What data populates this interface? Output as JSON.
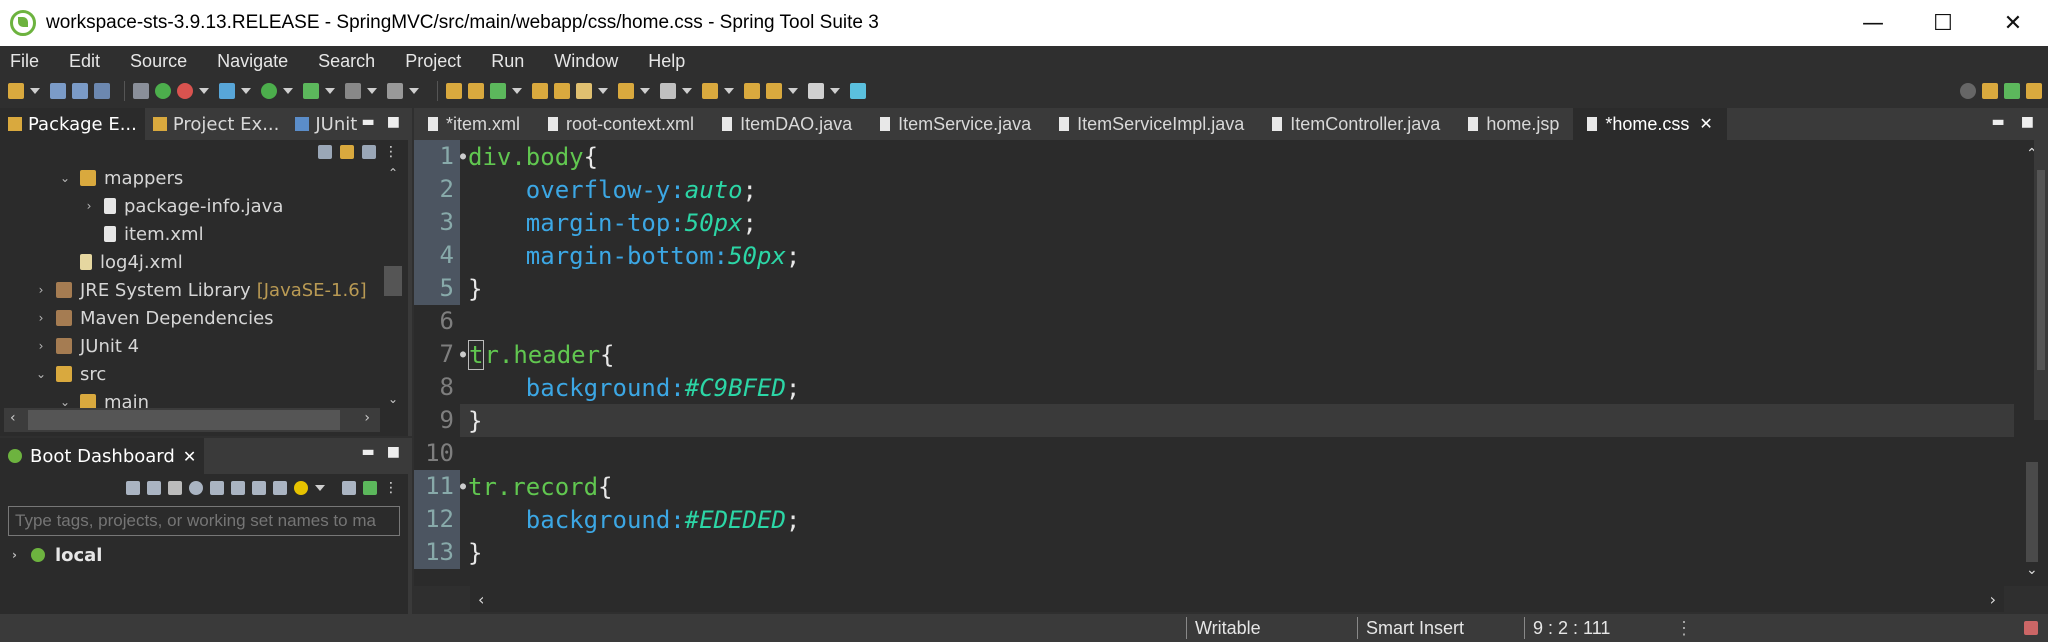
{
  "window": {
    "title": "workspace-sts-3.9.13.RELEASE - SpringMVC/src/main/webapp/css/home.css - Spring Tool Suite 3",
    "minimize": "—",
    "maximize": "☐",
    "close": "✕"
  },
  "menu": [
    "File",
    "Edit",
    "Source",
    "Navigate",
    "Search",
    "Project",
    "Run",
    "Window",
    "Help"
  ],
  "left_panel": {
    "tabs": [
      {
        "label": "Package E..."
      },
      {
        "label": "Project Ex..."
      },
      {
        "label": "JUnit"
      }
    ],
    "tree": [
      {
        "label": "mappers",
        "depth": 2,
        "arrow": "v",
        "icon": "package-icon"
      },
      {
        "label": "package-info.java",
        "depth": 3,
        "arrow": ">",
        "icon": "java-file-icon"
      },
      {
        "label": "item.xml",
        "depth": 3,
        "arrow": "",
        "icon": "xml-file-icon"
      },
      {
        "label": "log4j.xml",
        "depth": 2,
        "arrow": "",
        "icon": "xml-file-icon"
      },
      {
        "label": "JRE System Library",
        "suffix": "[JavaSE-1.6]",
        "depth": 1,
        "arrow": ">",
        "icon": "library-icon"
      },
      {
        "label": "Maven Dependencies",
        "depth": 1,
        "arrow": ">",
        "icon": "library-icon"
      },
      {
        "label": "JUnit 4",
        "depth": 1,
        "arrow": ">",
        "icon": "library-icon"
      },
      {
        "label": "src",
        "depth": 1,
        "arrow": "v",
        "icon": "folder-icon"
      },
      {
        "label": "main",
        "depth": 2,
        "arrow": "v",
        "icon": "folder-icon"
      }
    ]
  },
  "boot_dashboard": {
    "tab_label": "Boot Dashboard",
    "filter_placeholder": "Type tags, projects, or working set names to ma",
    "local_label": "local"
  },
  "editor": {
    "tabs": [
      {
        "label": "*item.xml",
        "active": false
      },
      {
        "label": "root-context.xml",
        "active": false
      },
      {
        "label": "ItemDAO.java",
        "active": false
      },
      {
        "label": "ItemService.java",
        "active": false
      },
      {
        "label": "ItemServiceImpl.java",
        "active": false
      },
      {
        "label": "ItemController.java",
        "active": false
      },
      {
        "label": "home.jsp",
        "active": false
      },
      {
        "label": "*home.css",
        "active": true
      }
    ],
    "lines": [
      {
        "num": "1",
        "selector": "div.body",
        "open": "{"
      },
      {
        "num": "2",
        "prop": "overflow-y",
        "value": "auto"
      },
      {
        "num": "3",
        "prop": "margin-top",
        "value": "50px"
      },
      {
        "num": "4",
        "prop": "margin-bottom",
        "value": "50px"
      },
      {
        "num": "5",
        "close": "}"
      },
      {
        "num": "6"
      },
      {
        "num": "7",
        "selector_first": "t",
        "selector": "r.header",
        "open": "{"
      },
      {
        "num": "8",
        "prop": "background",
        "value": "#C9BFED"
      },
      {
        "num": "9",
        "close": "}"
      },
      {
        "num": "10"
      },
      {
        "num": "11",
        "selector": "tr.record",
        "open": "{"
      },
      {
        "num": "12",
        "prop": "background",
        "value": "#EDEDED"
      },
      {
        "num": "13",
        "close": "}"
      }
    ]
  },
  "status": {
    "writable": "Writable",
    "insert_mode": "Smart Insert",
    "position": "9 : 2 : 111"
  },
  "colors": {
    "selector": "#61c750",
    "property": "#3ca7e4",
    "value": "#2cd6a6"
  }
}
